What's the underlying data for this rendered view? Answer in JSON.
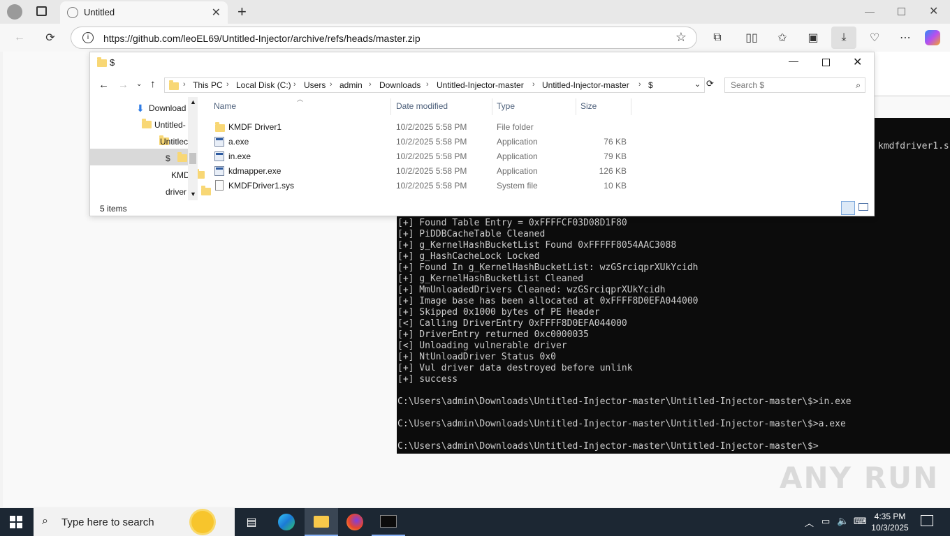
{
  "browser": {
    "tab_title": "Untitled",
    "url": "https://github.com/leoEL69/Untitled-Injector/archive/refs/heads/master.zip"
  },
  "explorer": {
    "window_title": "$",
    "breadcrumb": [
      "This PC",
      "Local Disk (C:)",
      "Users",
      "admin",
      "Downloads",
      "Untitled-Injector-master",
      "Untitled-Injector-master",
      "$"
    ],
    "search_placeholder": "Search $",
    "nav": [
      "Download",
      "Untitled-",
      "Untitlec",
      "$",
      "KMD",
      "driver"
    ],
    "columns": {
      "name": "Name",
      "date": "Date modified",
      "type": "Type",
      "size": "Size"
    },
    "files": [
      {
        "name": "KMDF Driver1",
        "date": "10/2/2025 5:58 PM",
        "type": "File folder",
        "size": "",
        "icon": "folder-icon"
      },
      {
        "name": "a.exe",
        "date": "10/2/2025 5:58 PM",
        "type": "Application",
        "size": "76 KB",
        "icon": "app-icon"
      },
      {
        "name": "in.exe",
        "date": "10/2/2025 5:58 PM",
        "type": "Application",
        "size": "79 KB",
        "icon": "app-icon"
      },
      {
        "name": "kdmapper.exe",
        "date": "10/2/2025 5:58 PM",
        "type": "Application",
        "size": "126 KB",
        "icon": "app-icon"
      },
      {
        "name": "KMDFDriver1.sys",
        "date": "10/2/2025 5:58 PM",
        "type": "System file",
        "size": "10 KB",
        "icon": "system-file-icon"
      }
    ],
    "status": "5 items"
  },
  "console": {
    "top_fragment": "kmdfdriver1.s",
    "lines": [
      "[+] Found Table Entry = 0xFFFFCF03D08D1F80",
      "[+] PiDDBCacheTable Cleaned",
      "[+] g_KernelHashBucketList Found 0xFFFFF8054AAC3088",
      "[+] g_HashCacheLock Locked",
      "[+] Found In g_KernelHashBucketList: wzGSrciqprXUkYcidh",
      "[+] g_KernelHashBucketList Cleaned",
      "[+] MmUnloadedDrivers Cleaned: wzGSrciqprXUkYcidh",
      "[+] Image base has been allocated at 0xFFFF8D0EFA044000",
      "[+] Skipped 0x1000 bytes of PE Header",
      "[<] Calling DriverEntry 0xFFFF8D0EFA044000",
      "[+] DriverEntry returned 0xc0000035",
      "[<] Unloading vulnerable driver",
      "[+] NtUnloadDriver Status 0x0",
      "[+] Vul driver data destroyed before unlink",
      "[+] success",
      "",
      "C:\\Users\\admin\\Downloads\\Untitled-Injector-master\\Untitled-Injector-master\\$>in.exe",
      "",
      "C:\\Users\\admin\\Downloads\\Untitled-Injector-master\\Untitled-Injector-master\\$>a.exe",
      "",
      "C:\\Users\\admin\\Downloads\\Untitled-Injector-master\\Untitled-Injector-master\\$>"
    ]
  },
  "taskbar": {
    "search_placeholder": "Type here to search",
    "time": "4:35 PM",
    "date": "10/3/2025"
  },
  "watermark": "ANY RUN"
}
